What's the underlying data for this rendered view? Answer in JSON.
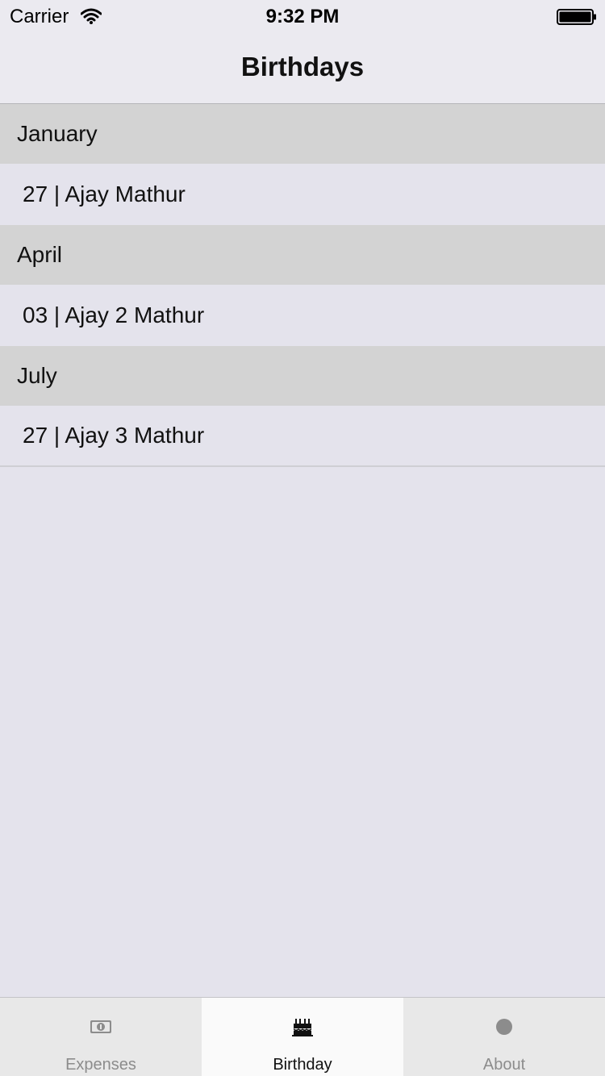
{
  "status_bar": {
    "carrier": "Carrier",
    "time": "9:32 PM"
  },
  "nav": {
    "title": "Birthdays"
  },
  "sections": [
    {
      "header": "January",
      "row": "27 | Ajay Mathur"
    },
    {
      "header": "April",
      "row": "03 | Ajay 2 Mathur"
    },
    {
      "header": "July",
      "row": "27 | Ajay 3 Mathur"
    }
  ],
  "tabs": [
    {
      "label": "Expenses",
      "icon": "money-icon",
      "selected": false
    },
    {
      "label": "Birthday",
      "icon": "cake-icon",
      "selected": true
    },
    {
      "label": "About",
      "icon": "circle-icon",
      "selected": false
    }
  ],
  "colors": {
    "section_header_bg": "#d3d3d3",
    "background": "#e4e3ec",
    "tab_selected_bg": "#fafafa",
    "tab_inactive_text": "#8c8c8c"
  }
}
